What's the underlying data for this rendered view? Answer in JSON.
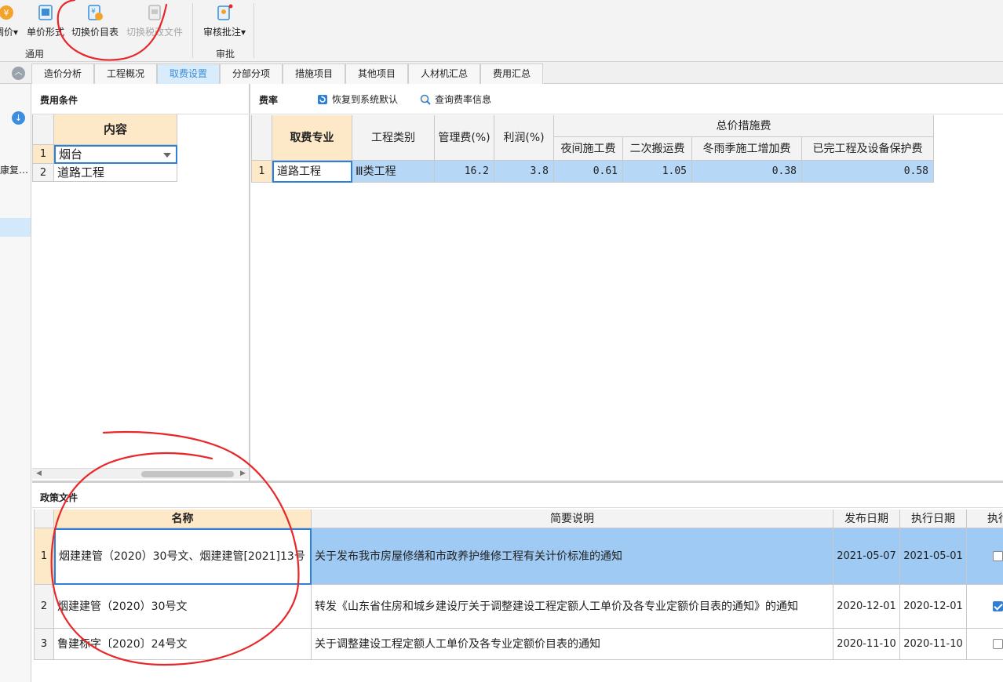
{
  "ribbon": {
    "buttons": [
      {
        "label": "调价▾",
        "disabled": false
      },
      {
        "label": "单价形式",
        "disabled": false
      },
      {
        "label": "切换价目表",
        "disabled": false
      },
      {
        "label": "切换税改文件",
        "disabled": true
      },
      {
        "label": "审核批注▾",
        "disabled": false
      }
    ],
    "groups": {
      "general": "通用",
      "review": "审批"
    }
  },
  "tabs": [
    "造价分析",
    "工程概况",
    "取费设置",
    "分部分项",
    "措施项目",
    "其他项目",
    "人材机汇总",
    "费用汇总"
  ],
  "active_tab": "取费设置",
  "leftnav": {
    "item_text": "康复…"
  },
  "fee_conditions": {
    "title": "费用条件",
    "header": "内容",
    "rows": [
      {
        "num": "1",
        "value": "烟台"
      },
      {
        "num": "2",
        "value": "道路工程"
      }
    ]
  },
  "rates": {
    "title": "费率",
    "restore_label": "恢复到系统默认",
    "query_label": "查询费率信息",
    "headers": {
      "specialty": "取费专业",
      "category": "工程类别",
      "management": "管理费(%)",
      "profit": "利润(%)",
      "total_measures": "总价措施费",
      "night": "夜间施工费",
      "secondary": "二次搬运费",
      "winter_rain": "冬雨季施工增加费",
      "protection": "已完工程及设备保护费"
    },
    "rows": [
      {
        "num": "1",
        "specialty": "道路工程",
        "category": "Ⅲ类工程",
        "management": "16.2",
        "profit": "3.8",
        "night": "0.61",
        "secondary": "1.05",
        "winter_rain": "0.38",
        "protection": "0.58"
      }
    ]
  },
  "policy": {
    "title": "政策文件",
    "headers": {
      "name": "名称",
      "desc": "简要说明",
      "publish": "发布日期",
      "execute": "执行日期",
      "exec": "执行"
    },
    "rows": [
      {
        "num": "1",
        "name": "烟建建管（2020）30号文、烟建建管[2021]13号",
        "desc": "关于发布我市房屋修缮和市政养护维修工程有关计价标准的通知",
        "publish": "2021-05-07",
        "execute": "2021-05-01",
        "checked": false
      },
      {
        "num": "2",
        "name": "烟建建管（2020）30号文",
        "desc": "转发《山东省住房和城乡建设厅关于调整建设工程定额人工单价及各专业定额价目表的通知》的通知",
        "publish": "2020-12-01",
        "execute": "2020-12-01",
        "checked": true
      },
      {
        "num": "3",
        "name": "鲁建标字〔2020〕24号文",
        "desc": "关于调整建设工程定额人工单价及各专业定额价目表的通知",
        "publish": "2020-11-10",
        "execute": "2020-11-10",
        "checked": false
      }
    ]
  },
  "colors": {
    "selection_blue": "#9fcaf3",
    "header_orange": "#fde8c8",
    "accent_blue": "#3a8ed8",
    "annotation_red": "#e8272a"
  }
}
